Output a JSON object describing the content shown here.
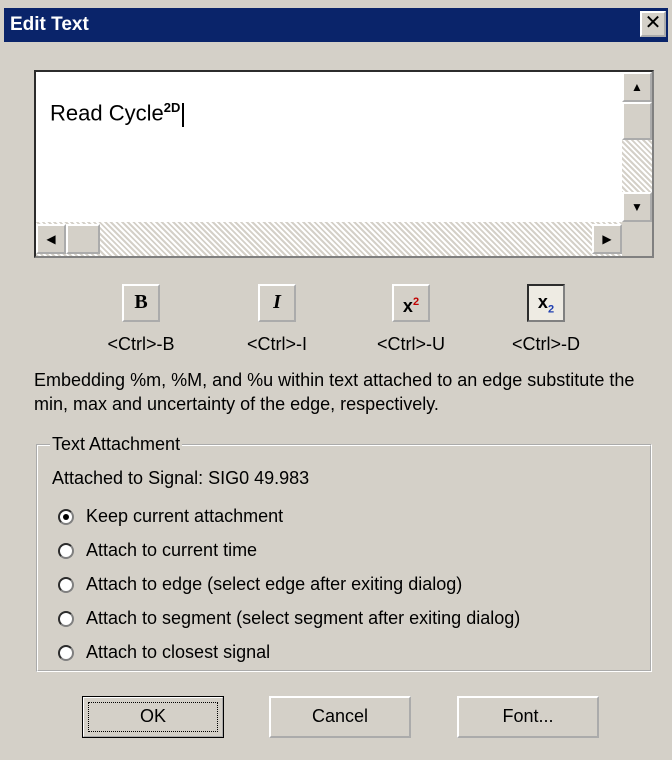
{
  "window": {
    "title": "Edit Text",
    "close_glyph": "✕"
  },
  "editor": {
    "text": "Read Cycle",
    "superscript": "2",
    "trailing": "D",
    "scroll_up": "▲",
    "scroll_down": "▼",
    "scroll_left": "◀",
    "scroll_right": "▶"
  },
  "format": {
    "bold_glyph": "B",
    "italic_glyph": "I",
    "superscript_glyph": "x",
    "superscript_mark": "2",
    "subscript_glyph": "x",
    "subscript_mark": "2",
    "bold_shortcut": "<Ctrl>-B",
    "italic_shortcut": "<Ctrl>-I",
    "superscript_shortcut": "<Ctrl>-U",
    "subscript_shortcut": "<Ctrl>-D"
  },
  "note": "Embedding %m, %M, and %u  within text attached to an edge substitute the min, max and uncertainty of the edge, respectively.",
  "attachment": {
    "legend": "Text Attachment",
    "attached_to": "Attached to Signal: SIG0 49.983",
    "options": [
      {
        "label": "Keep current attachment",
        "checked": true
      },
      {
        "label": "Attach to current time",
        "checked": false
      },
      {
        "label": "Attach to edge (select edge after exiting dialog)",
        "checked": false
      },
      {
        "label": "Attach to segment (select segment after exiting dialog)",
        "checked": false
      },
      {
        "label": "Attach to closest signal",
        "checked": false
      }
    ]
  },
  "buttons": {
    "ok": "OK",
    "cancel": "Cancel",
    "font": "Font..."
  },
  "colors": {
    "titlebar": "#0a246a",
    "face": "#d4d0c8"
  }
}
